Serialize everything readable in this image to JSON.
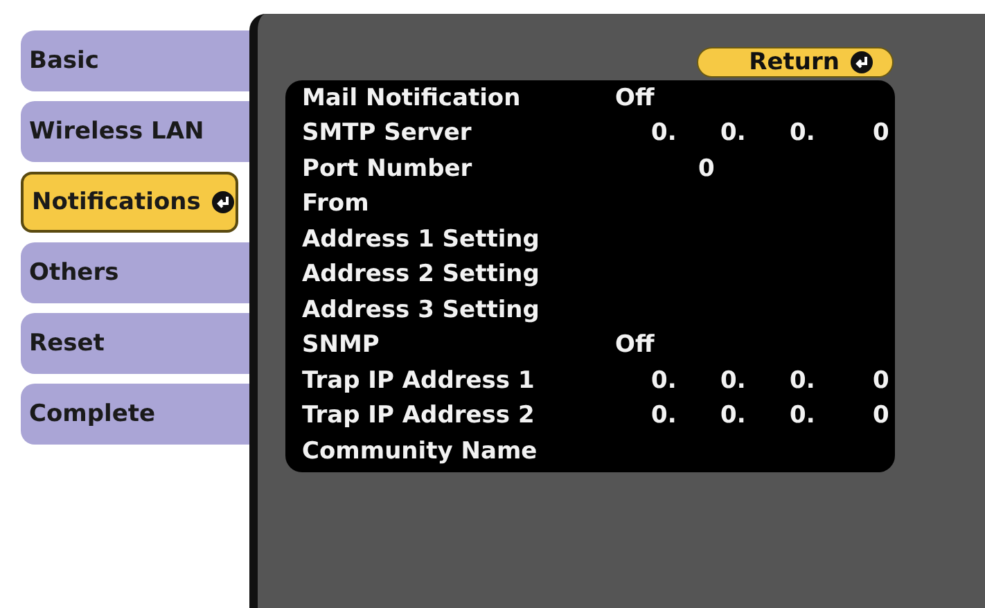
{
  "tabs": [
    {
      "label": "Basic",
      "selected": false
    },
    {
      "label": "Wireless LAN",
      "selected": false
    },
    {
      "label": "Notifications",
      "selected": true
    },
    {
      "label": "Others",
      "selected": false
    },
    {
      "label": "Reset",
      "selected": false
    },
    {
      "label": "Complete",
      "selected": false
    }
  ],
  "return_button": {
    "label": "Return"
  },
  "settings": [
    {
      "label": "Mail Notification",
      "kind": "text",
      "value": "Off"
    },
    {
      "label": "SMTP Server",
      "kind": "ip",
      "octets": [
        "0.",
        "0.",
        "0.",
        "0"
      ]
    },
    {
      "label": "Port Number",
      "kind": "number",
      "value": "0"
    },
    {
      "label": "From",
      "kind": "empty"
    },
    {
      "label": "Address 1 Setting",
      "kind": "empty"
    },
    {
      "label": "Address 2 Setting",
      "kind": "empty"
    },
    {
      "label": "Address 3 Setting",
      "kind": "empty"
    },
    {
      "label": "SNMP",
      "kind": "text",
      "value": "Off"
    },
    {
      "label": "Trap IP Address 1",
      "kind": "ip",
      "octets": [
        "0.",
        "0.",
        "0.",
        "0"
      ]
    },
    {
      "label": "Trap IP Address 2",
      "kind": "ip",
      "octets": [
        "0.",
        "0.",
        "0.",
        "0"
      ]
    },
    {
      "label": "Community Name",
      "kind": "empty"
    }
  ]
}
